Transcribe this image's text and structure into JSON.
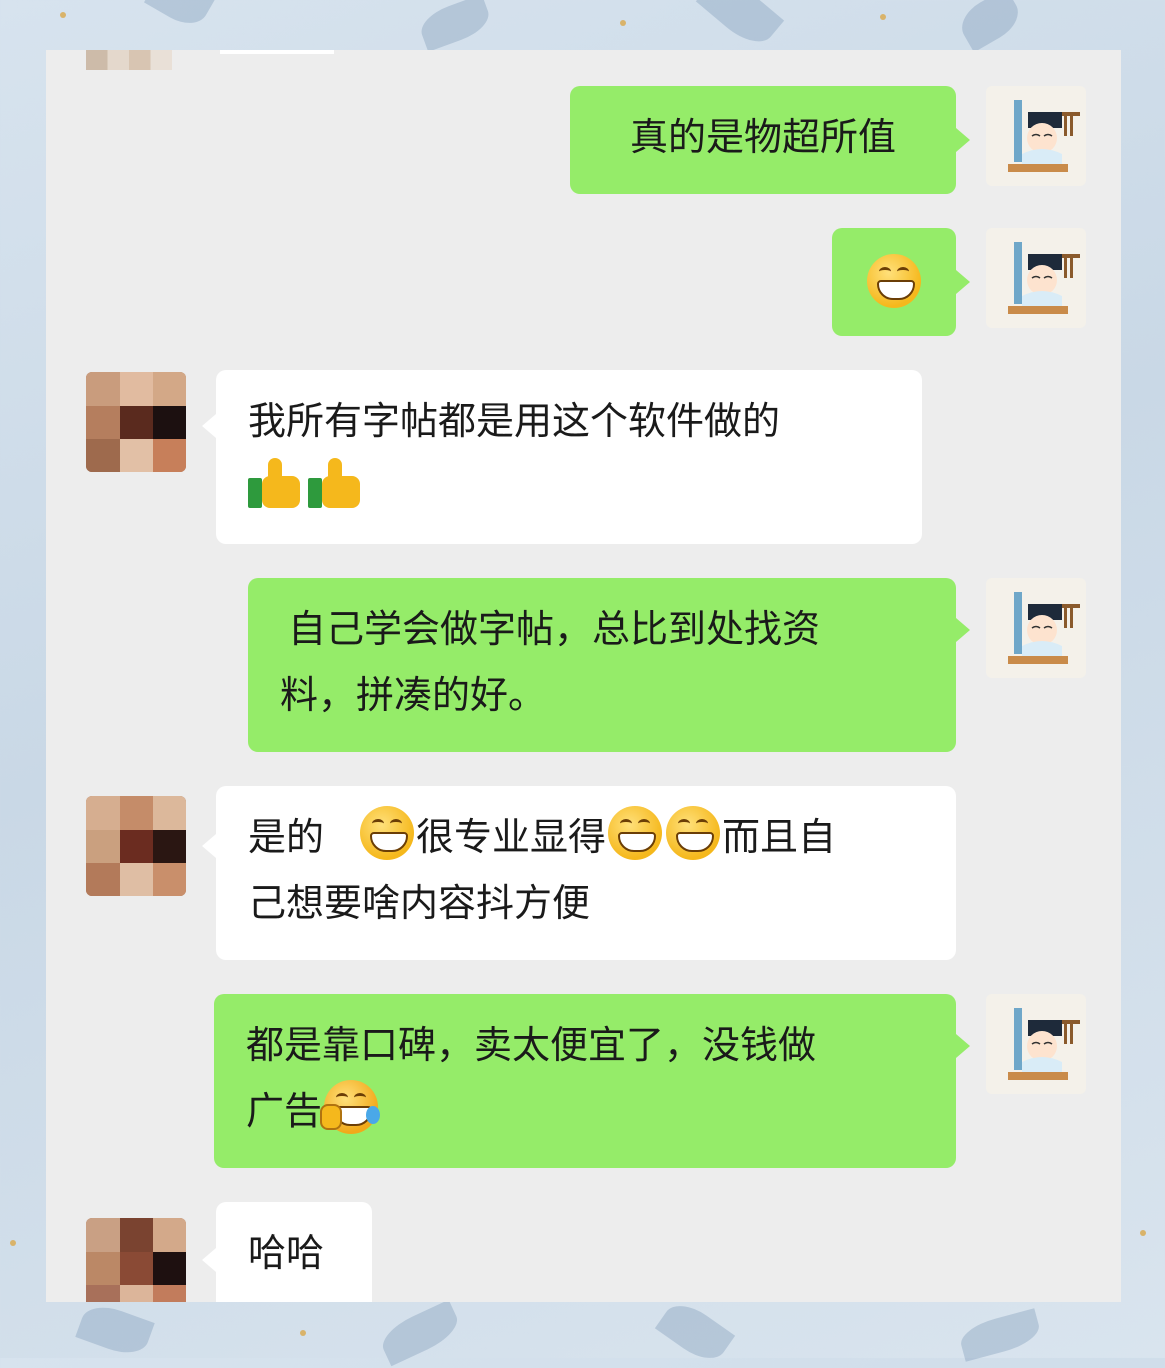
{
  "chat": {
    "messages": [
      {
        "sender": "self",
        "text": "真的是物超所值"
      },
      {
        "sender": "self",
        "emoji": "grin-emoji"
      },
      {
        "sender": "other",
        "text": "我所有字帖都是用这个软件做的",
        "emoji": "thumbs-up-emoji"
      },
      {
        "sender": "self",
        "line1": "自己学会做字帖，总比到处找资",
        "line2": "料，拼凑的好。"
      },
      {
        "sender": "other",
        "p1": "是的",
        "p2": "很专业显得",
        "p3": "而且自",
        "line2": "己想要啥内容抖方便"
      },
      {
        "sender": "self",
        "line1": "都是靠口碑，卖太便宜了，没钱做",
        "line2": "广告"
      },
      {
        "sender": "other",
        "text": "哈哈"
      }
    ]
  },
  "colors": {
    "self_bubble": "#95ec69",
    "other_bubble": "#ffffff",
    "chat_background": "#ededed"
  },
  "avatars": {
    "self": "scholar-avatar-icon",
    "other": "pixelated-avatar"
  }
}
